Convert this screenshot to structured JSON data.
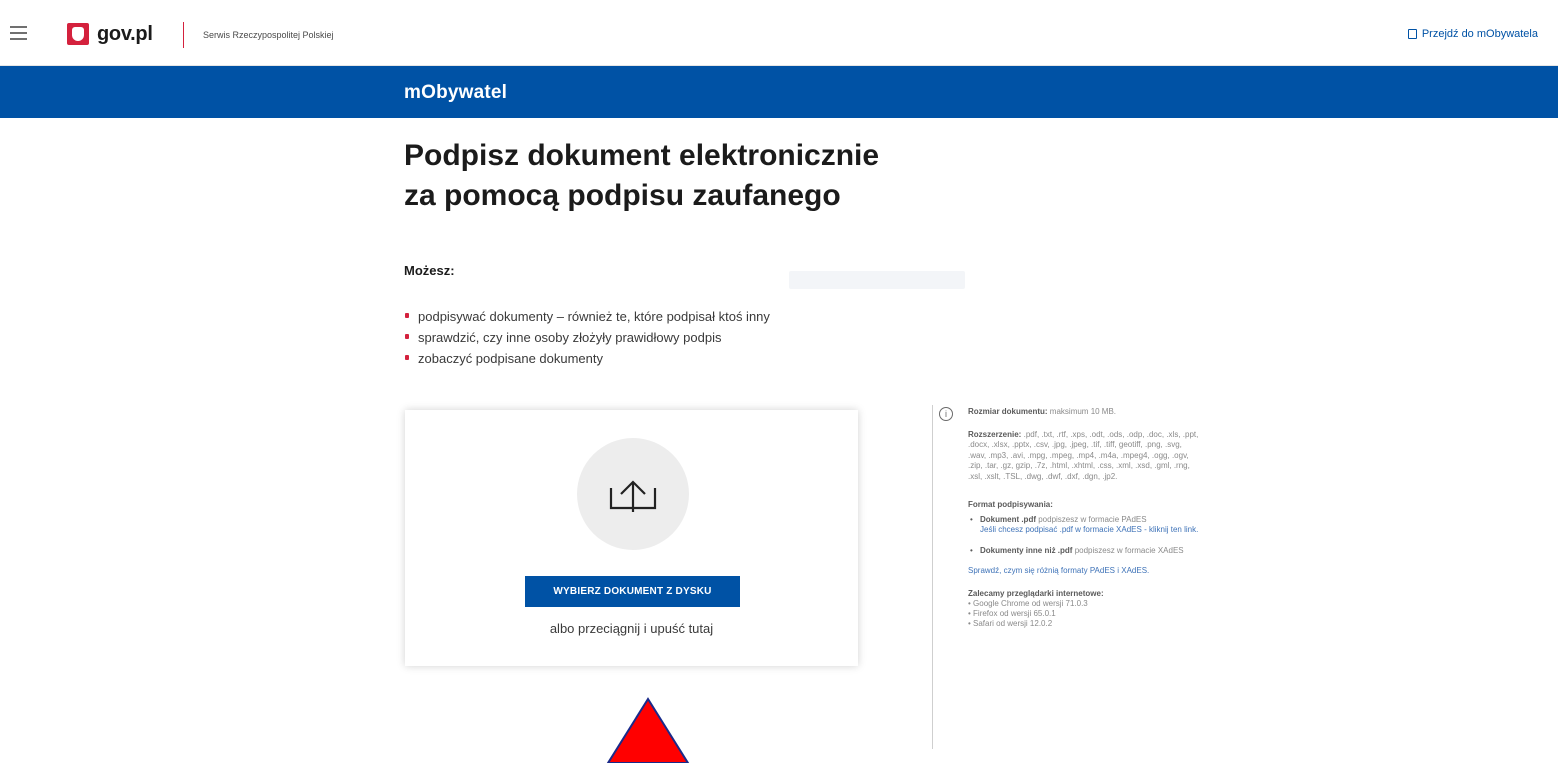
{
  "header": {
    "logo_text": "gov.pl",
    "service_name": "Serwis Rzeczypospolitej Polskiej",
    "go_link": "Przejdź do mObywatela"
  },
  "band": {
    "title": "mObywatel"
  },
  "page": {
    "title_line1": "Podpisz dokument elektronicznie",
    "title_line2": "za pomocą podpisu zaufanego",
    "you_can_label": "Możesz:",
    "bullets": [
      "podpisywać dokumenty – również te, które podpisał ktoś inny",
      "sprawdzić, czy inne osoby złożyły prawidłowy podpis",
      "zobaczyć podpisane dokumenty"
    ]
  },
  "upload": {
    "button_label": "WYBIERZ DOKUMENT Z DYSKU",
    "drag_text": "albo przeciągnij i upuść tutaj"
  },
  "info": {
    "size_label": "Rozmiar dokumentu:",
    "size_value": "maksimum 10 MB.",
    "ext_label": "Rozszerzenie:",
    "ext_value": ".pdf, .txt, .rtf, .xps, .odt, .ods, .odp, .doc, .xls, .ppt, .docx, .xlsx, .pptx, .csv, .jpg, .jpeg, .tif, .tiff, geotiff, .png, .svg, .wav, .mp3, .avi, .mpg, .mpeg, .mp4, .m4a, .mpeg4, .ogg, .ogv, .zip, .tar, .gz, gzip, .7z, .html, .xhtml, .css, .xml, .xsd, .gml, .rng, .xsl, .xslt, .TSL, .dwg, .dwf, .dxf, .dgn, .jp2.",
    "format_label": "Format podpisywania:",
    "pdf_bold": "Dokument .pdf",
    "pdf_text": "podpiszesz w formacie PAdES",
    "pdf_link": "Jeśli chcesz podpisać .pdf w formacie XAdES - kliknij ten link.",
    "other_bold": "Dokumenty inne niż .pdf",
    "other_text": "podpiszesz w formacie XAdES",
    "compare_link": "Sprawdź, czym się różnią formaty PAdES i XAdES.",
    "browsers_label": "Zalecamy przeglądarki internetowe:",
    "browsers": [
      "• Google Chrome od wersji 71.0.3",
      "• Firefox od wersji 65.0.1",
      "• Safari od wersji 12.0.2"
    ]
  },
  "icons": {
    "menu": "hamburger-icon",
    "logo": "eagle-emblem-icon",
    "go": "door-icon",
    "upload": "upload-arrow-icon",
    "info": "info-icon",
    "annotation": "red-triangle-arrow"
  },
  "colors": {
    "brand_blue": "#0052a5",
    "accent_red": "#d4213d",
    "annotation_red": "#ff0000"
  }
}
